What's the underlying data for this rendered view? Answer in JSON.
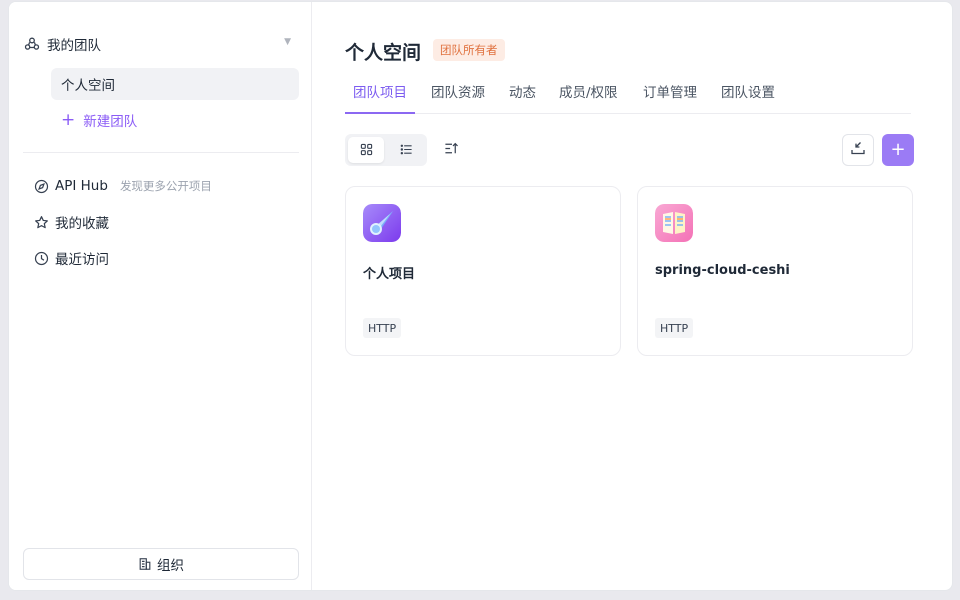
{
  "sidebar": {
    "team_header": "我的团队",
    "personal_space": "个人空间",
    "new_team": "新建团队",
    "nav": [
      {
        "label": "API Hub",
        "sub": "发现更多公开项目"
      },
      {
        "label": "我的收藏"
      },
      {
        "label": "最近访问"
      }
    ],
    "org_button": "组织"
  },
  "main": {
    "title": "个人空间",
    "owner_badge": "团队所有者",
    "tabs": [
      {
        "label": "团队项目"
      },
      {
        "label": "团队资源"
      },
      {
        "label": "动态"
      },
      {
        "label": "成员/权限"
      },
      {
        "label": "订单管理"
      },
      {
        "label": "团队设置"
      }
    ],
    "add_label": "+",
    "projects": [
      {
        "name": "个人项目",
        "tag": "HTTP"
      },
      {
        "name": "spring-cloud-ceshi",
        "tag": "HTTP"
      }
    ]
  },
  "colors": {
    "accent": "#8b68f2",
    "badge_bg": "#fdece4",
    "badge_text": "#e0713e"
  },
  "icons": {
    "team": "team-icon",
    "caret": "caret-down-icon",
    "compass": "compass-icon",
    "star": "star-icon",
    "clock": "clock-icon",
    "org": "building-icon",
    "grid": "grid-view-icon",
    "list": "list-view-icon",
    "sort": "sort-icon",
    "import": "import-icon",
    "project1": "comet-icon",
    "project2": "book-icon"
  }
}
